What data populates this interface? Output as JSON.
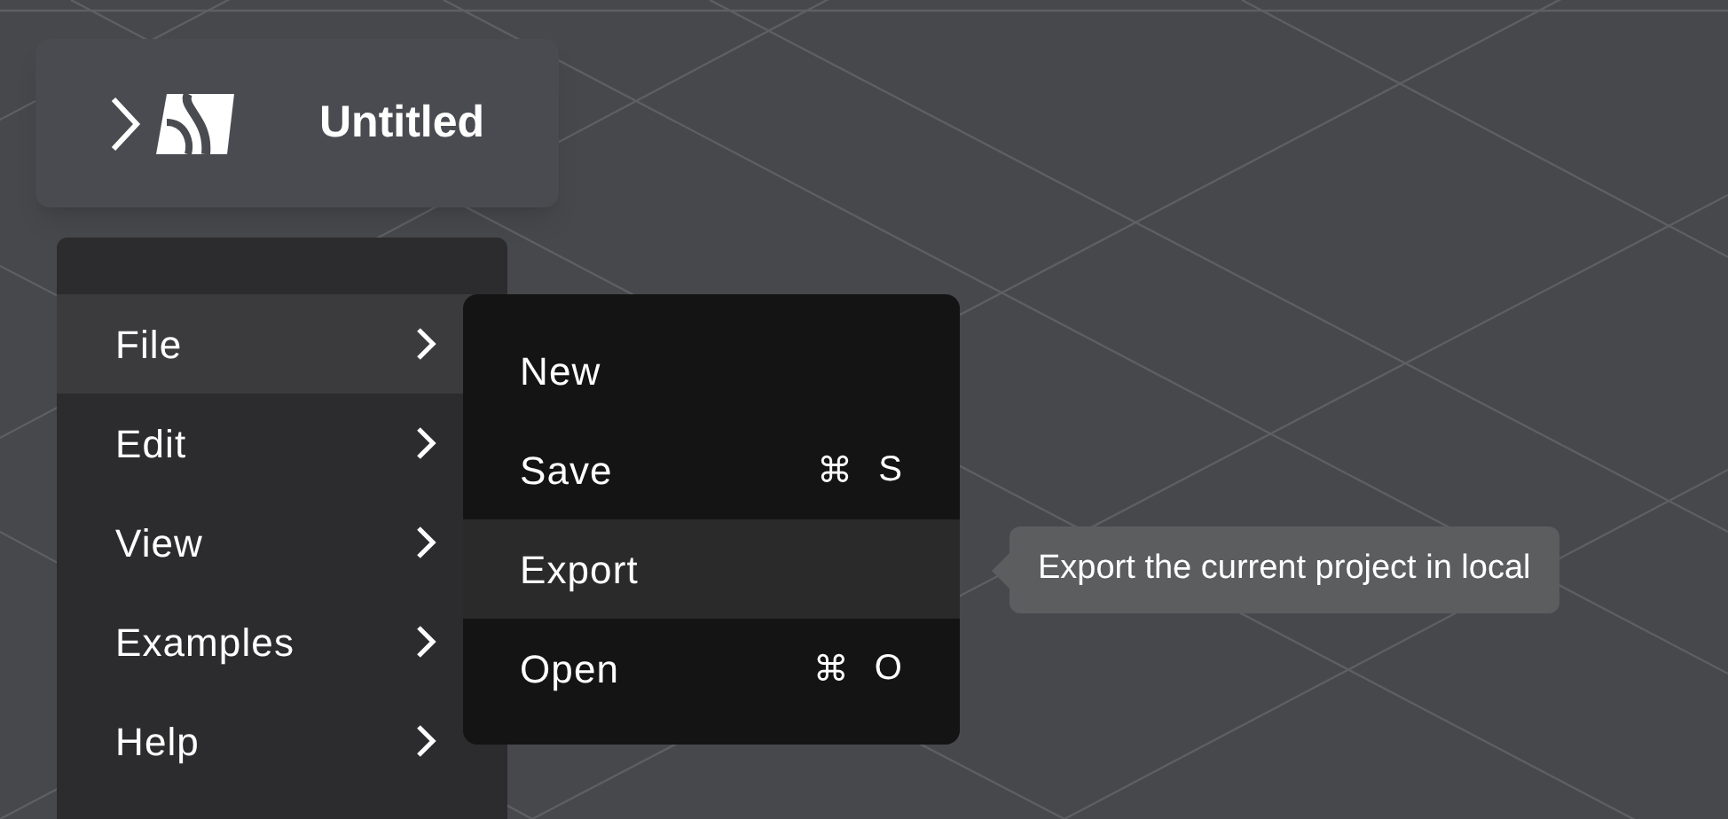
{
  "header": {
    "title": "Untitled"
  },
  "menu": {
    "items": [
      {
        "label": "File",
        "selected": true
      },
      {
        "label": "Edit",
        "selected": false
      },
      {
        "label": "View",
        "selected": false
      },
      {
        "label": "Examples",
        "selected": false
      },
      {
        "label": "Help",
        "selected": false
      }
    ]
  },
  "submenu": {
    "items": [
      {
        "label": "New",
        "selected": false
      },
      {
        "label": "Save",
        "shortcut_symbol": "⌘",
        "shortcut_key": "S",
        "selected": false
      },
      {
        "label": "Export",
        "selected": true
      },
      {
        "label": "Open",
        "shortcut_symbol": "⌘",
        "shortcut_key": "O",
        "selected": false
      }
    ]
  },
  "tooltip": {
    "text": "Export the current project in local"
  }
}
